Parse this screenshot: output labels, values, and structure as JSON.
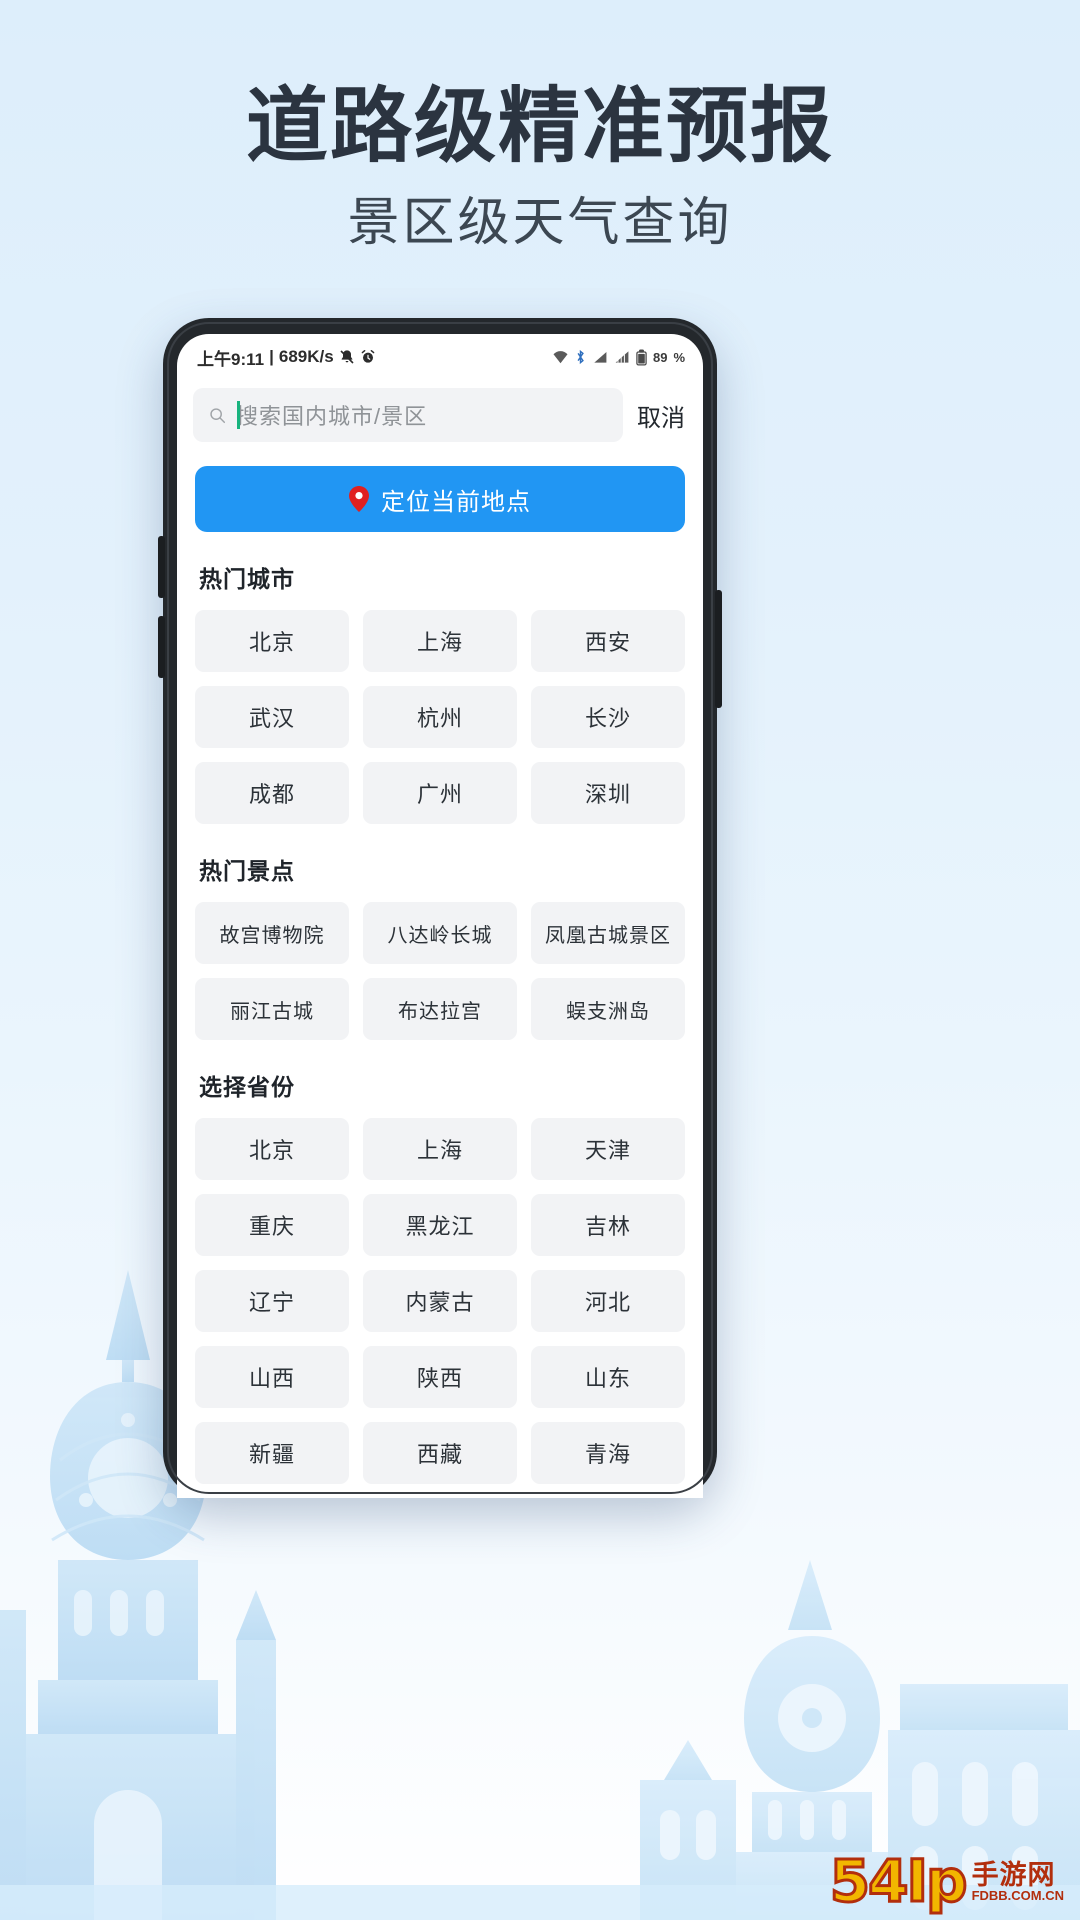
{
  "promo": {
    "headline": "道路级精准预报",
    "subheadline": "景区级天气查询"
  },
  "colors": {
    "accent_blue": "#2196f3",
    "pin_red": "#e02020",
    "chip_bg": "#f2f3f5",
    "page_bg": "#e3f1fc",
    "headline_text": "#2b3440"
  },
  "phone": {
    "statusbar": {
      "time": "上午9:11",
      "separator": "|",
      "network_speed": "689K/s",
      "mute_icon": "bell-mute-icon",
      "alarm_icon": "alarm-clock-icon",
      "wifi_icon": "wifi-icon",
      "bluetooth_icon": "bluetooth-icon",
      "signal_icon": "signal-bars-icon",
      "signal2_icon": "signal-bars-icon",
      "battery_icon": "battery-icon",
      "battery_level": "89",
      "battery_unit": "%"
    },
    "search": {
      "icon": "search-icon",
      "placeholder": "搜索国内城市/景区",
      "value": "",
      "cancel_label": "取消"
    },
    "locate": {
      "icon": "map-pin-icon",
      "label": "定位当前地点"
    },
    "sections": [
      {
        "id": "hot-cities",
        "title": "热门城市",
        "items": [
          "北京",
          "上海",
          "西安",
          "武汉",
          "杭州",
          "长沙",
          "成都",
          "广州",
          "深圳"
        ]
      },
      {
        "id": "hot-spots",
        "title": "热门景点",
        "items": [
          "故宫博物院",
          "八达岭长城",
          "凤凰古城景区",
          "丽江古城",
          "布达拉宫",
          "蜈支洲岛"
        ]
      },
      {
        "id": "provinces",
        "title": "选择省份",
        "items": [
          "北京",
          "上海",
          "天津",
          "重庆",
          "黑龙江",
          "吉林",
          "辽宁",
          "内蒙古",
          "河北",
          "山西",
          "陕西",
          "山东",
          "新疆",
          "西藏",
          "青海"
        ]
      }
    ]
  },
  "watermark": {
    "main": "54Ip",
    "cn": "手游网",
    "url": "FDBB.COM.CN"
  }
}
